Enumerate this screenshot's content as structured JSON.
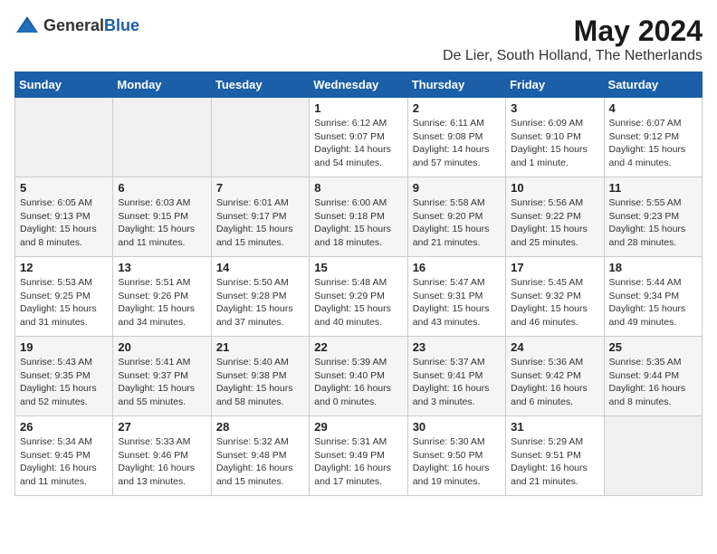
{
  "header": {
    "logo_general": "General",
    "logo_blue": "Blue",
    "title": "May 2024",
    "subtitle": "De Lier, South Holland, The Netherlands"
  },
  "days_of_week": [
    "Sunday",
    "Monday",
    "Tuesday",
    "Wednesday",
    "Thursday",
    "Friday",
    "Saturday"
  ],
  "weeks": [
    [
      {
        "day": "",
        "info": ""
      },
      {
        "day": "",
        "info": ""
      },
      {
        "day": "",
        "info": ""
      },
      {
        "day": "1",
        "info": "Sunrise: 6:12 AM\nSunset: 9:07 PM\nDaylight: 14 hours\nand 54 minutes."
      },
      {
        "day": "2",
        "info": "Sunrise: 6:11 AM\nSunset: 9:08 PM\nDaylight: 14 hours\nand 57 minutes."
      },
      {
        "day": "3",
        "info": "Sunrise: 6:09 AM\nSunset: 9:10 PM\nDaylight: 15 hours\nand 1 minute."
      },
      {
        "day": "4",
        "info": "Sunrise: 6:07 AM\nSunset: 9:12 PM\nDaylight: 15 hours\nand 4 minutes."
      }
    ],
    [
      {
        "day": "5",
        "info": "Sunrise: 6:05 AM\nSunset: 9:13 PM\nDaylight: 15 hours\nand 8 minutes."
      },
      {
        "day": "6",
        "info": "Sunrise: 6:03 AM\nSunset: 9:15 PM\nDaylight: 15 hours\nand 11 minutes."
      },
      {
        "day": "7",
        "info": "Sunrise: 6:01 AM\nSunset: 9:17 PM\nDaylight: 15 hours\nand 15 minutes."
      },
      {
        "day": "8",
        "info": "Sunrise: 6:00 AM\nSunset: 9:18 PM\nDaylight: 15 hours\nand 18 minutes."
      },
      {
        "day": "9",
        "info": "Sunrise: 5:58 AM\nSunset: 9:20 PM\nDaylight: 15 hours\nand 21 minutes."
      },
      {
        "day": "10",
        "info": "Sunrise: 5:56 AM\nSunset: 9:22 PM\nDaylight: 15 hours\nand 25 minutes."
      },
      {
        "day": "11",
        "info": "Sunrise: 5:55 AM\nSunset: 9:23 PM\nDaylight: 15 hours\nand 28 minutes."
      }
    ],
    [
      {
        "day": "12",
        "info": "Sunrise: 5:53 AM\nSunset: 9:25 PM\nDaylight: 15 hours\nand 31 minutes."
      },
      {
        "day": "13",
        "info": "Sunrise: 5:51 AM\nSunset: 9:26 PM\nDaylight: 15 hours\nand 34 minutes."
      },
      {
        "day": "14",
        "info": "Sunrise: 5:50 AM\nSunset: 9:28 PM\nDaylight: 15 hours\nand 37 minutes."
      },
      {
        "day": "15",
        "info": "Sunrise: 5:48 AM\nSunset: 9:29 PM\nDaylight: 15 hours\nand 40 minutes."
      },
      {
        "day": "16",
        "info": "Sunrise: 5:47 AM\nSunset: 9:31 PM\nDaylight: 15 hours\nand 43 minutes."
      },
      {
        "day": "17",
        "info": "Sunrise: 5:45 AM\nSunset: 9:32 PM\nDaylight: 15 hours\nand 46 minutes."
      },
      {
        "day": "18",
        "info": "Sunrise: 5:44 AM\nSunset: 9:34 PM\nDaylight: 15 hours\nand 49 minutes."
      }
    ],
    [
      {
        "day": "19",
        "info": "Sunrise: 5:43 AM\nSunset: 9:35 PM\nDaylight: 15 hours\nand 52 minutes."
      },
      {
        "day": "20",
        "info": "Sunrise: 5:41 AM\nSunset: 9:37 PM\nDaylight: 15 hours\nand 55 minutes."
      },
      {
        "day": "21",
        "info": "Sunrise: 5:40 AM\nSunset: 9:38 PM\nDaylight: 15 hours\nand 58 minutes."
      },
      {
        "day": "22",
        "info": "Sunrise: 5:39 AM\nSunset: 9:40 PM\nDaylight: 16 hours\nand 0 minutes."
      },
      {
        "day": "23",
        "info": "Sunrise: 5:37 AM\nSunset: 9:41 PM\nDaylight: 16 hours\nand 3 minutes."
      },
      {
        "day": "24",
        "info": "Sunrise: 5:36 AM\nSunset: 9:42 PM\nDaylight: 16 hours\nand 6 minutes."
      },
      {
        "day": "25",
        "info": "Sunrise: 5:35 AM\nSunset: 9:44 PM\nDaylight: 16 hours\nand 8 minutes."
      }
    ],
    [
      {
        "day": "26",
        "info": "Sunrise: 5:34 AM\nSunset: 9:45 PM\nDaylight: 16 hours\nand 11 minutes."
      },
      {
        "day": "27",
        "info": "Sunrise: 5:33 AM\nSunset: 9:46 PM\nDaylight: 16 hours\nand 13 minutes."
      },
      {
        "day": "28",
        "info": "Sunrise: 5:32 AM\nSunset: 9:48 PM\nDaylight: 16 hours\nand 15 minutes."
      },
      {
        "day": "29",
        "info": "Sunrise: 5:31 AM\nSunset: 9:49 PM\nDaylight: 16 hours\nand 17 minutes."
      },
      {
        "day": "30",
        "info": "Sunrise: 5:30 AM\nSunset: 9:50 PM\nDaylight: 16 hours\nand 19 minutes."
      },
      {
        "day": "31",
        "info": "Sunrise: 5:29 AM\nSunset: 9:51 PM\nDaylight: 16 hours\nand 21 minutes."
      },
      {
        "day": "",
        "info": ""
      }
    ]
  ]
}
